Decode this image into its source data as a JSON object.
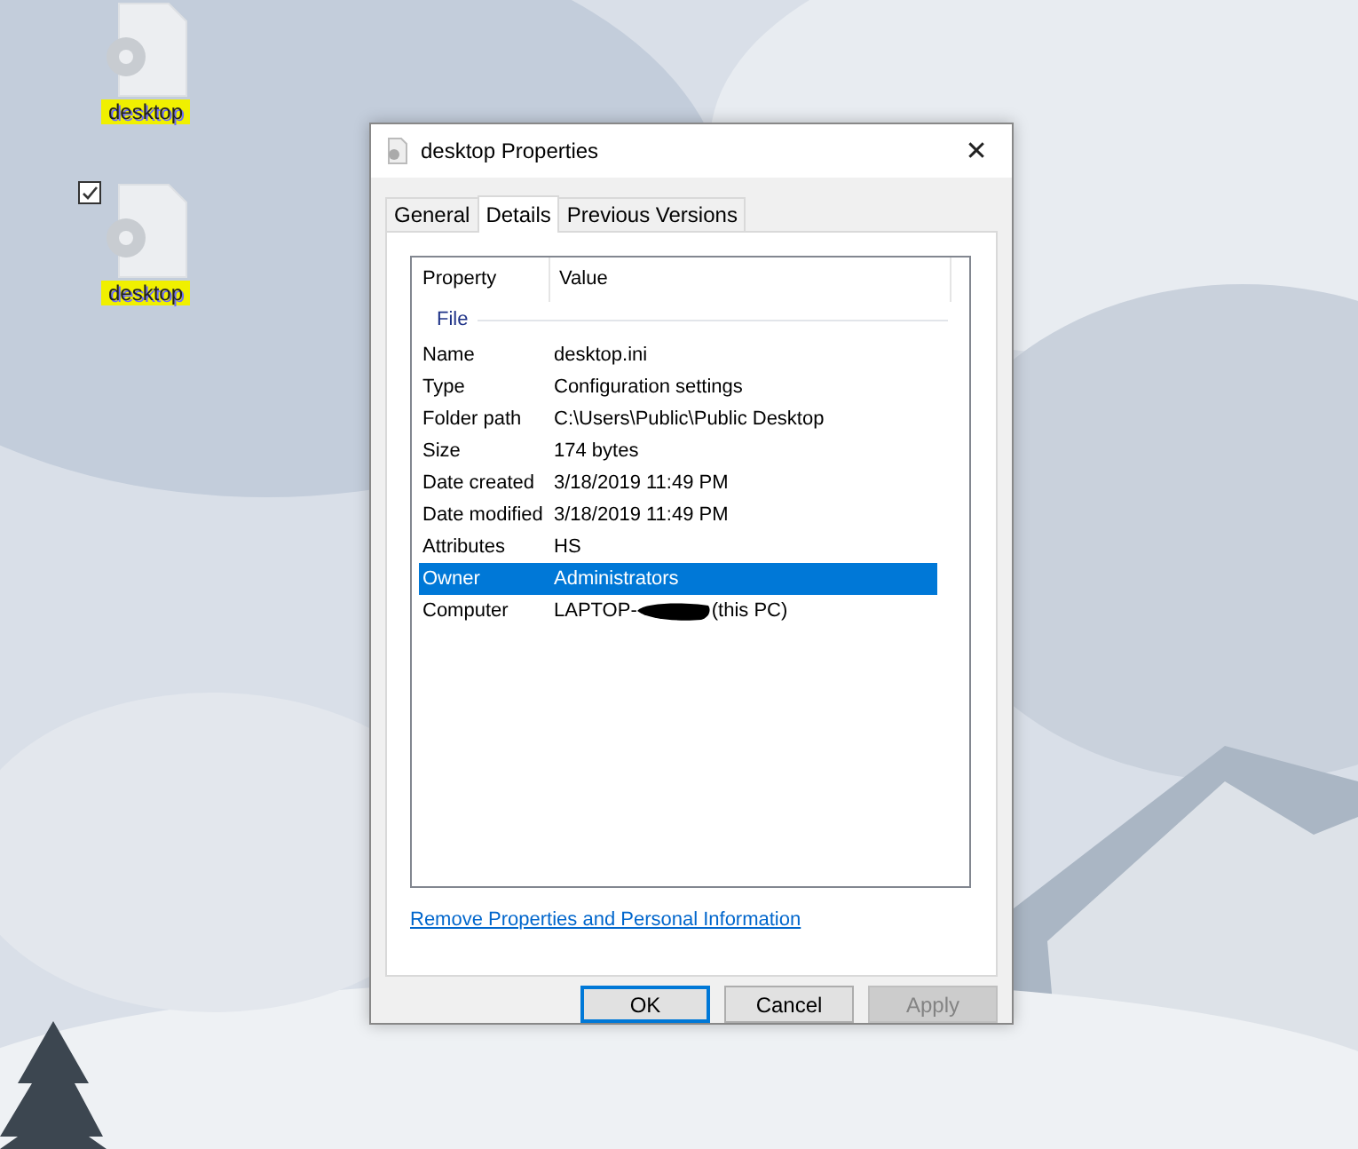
{
  "desktop_icons": [
    {
      "label": "desktop",
      "highlighted": true
    },
    {
      "label": "desktop",
      "checked": true,
      "highlighted": true
    }
  ],
  "window": {
    "title": "desktop Properties",
    "close": "✕"
  },
  "tabs": [
    {
      "label": "General",
      "selected": false
    },
    {
      "label": "Details",
      "selected": true
    },
    {
      "label": "Previous Versions",
      "selected": false
    }
  ],
  "table": {
    "columns": [
      "Property",
      "Value"
    ],
    "group": "File",
    "rows": [
      {
        "property": "Name",
        "value": "desktop.ini",
        "selected": false
      },
      {
        "property": "Type",
        "value": "Configuration settings",
        "selected": false
      },
      {
        "property": "Folder path",
        "value": "C:\\Users\\Public\\Public Desktop",
        "selected": false
      },
      {
        "property": "Size",
        "value": "174 bytes",
        "selected": false
      },
      {
        "property": "Date created",
        "value": "3/18/2019 11:49 PM",
        "selected": false
      },
      {
        "property": "Date modified",
        "value": "3/18/2019 11:49 PM",
        "selected": false
      },
      {
        "property": "Attributes",
        "value": "HS",
        "selected": false
      },
      {
        "property": "Owner",
        "value": "Administrators",
        "selected": true
      },
      {
        "property": "Computer",
        "value": "LAPTOP-",
        "redacted": true,
        "suffix": "(this PC)",
        "selected": false
      }
    ]
  },
  "link": "Remove Properties and Personal Information",
  "buttons": [
    {
      "label": "OK",
      "default": true,
      "disabled": false
    },
    {
      "label": "Cancel",
      "default": false,
      "disabled": false
    },
    {
      "label": "Apply",
      "default": false,
      "disabled": true
    }
  ]
}
